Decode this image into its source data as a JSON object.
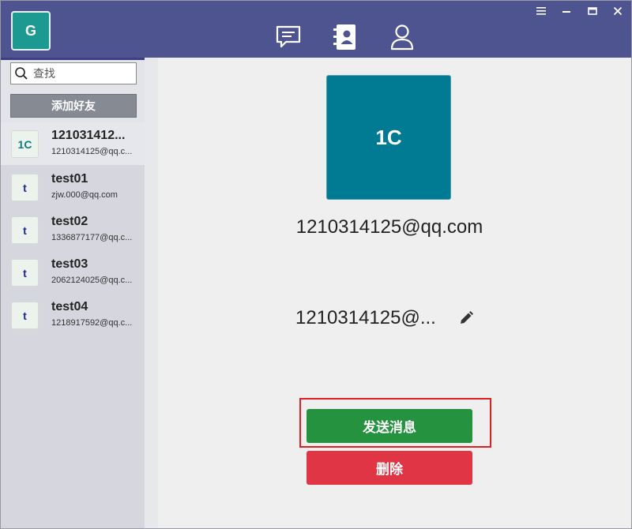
{
  "app": {
    "avatar_letter": "G",
    "accent_color": "#4e5490"
  },
  "nav": {
    "items": [
      {
        "icon": "chat-bubble-icon"
      },
      {
        "icon": "address-book-icon"
      },
      {
        "icon": "user-profile-icon"
      }
    ]
  },
  "window_controls": {
    "menu": "≡",
    "minimize": "—",
    "maximize": "□",
    "close": "✕"
  },
  "sidebar": {
    "search": {
      "placeholder": "查找",
      "value": ""
    },
    "add_friend_label": "添加好友",
    "contacts": [
      {
        "avatar": "1C",
        "name": "121031412...",
        "email": "1210314125@qq.c...",
        "selected": true
      },
      {
        "avatar": "t",
        "name": "test01",
        "email": "zjw.000@qq.com",
        "selected": false
      },
      {
        "avatar": "t",
        "name": "test02",
        "email": "1336877177@qq.c...",
        "selected": false
      },
      {
        "avatar": "t",
        "name": "test03",
        "email": "2062124025@qq.c...",
        "selected": false
      },
      {
        "avatar": "t",
        "name": "test04",
        "email": "1218917592@qq.c...",
        "selected": false
      }
    ]
  },
  "profile": {
    "avatar_text": "1C",
    "avatar_color": "#007b93",
    "email": "1210314125@qq.com",
    "nickname": "1210314125@..."
  },
  "actions": {
    "send_message_label": "发送消息",
    "send_message_color": "#25923f",
    "delete_label": "删除",
    "delete_color": "#e03545"
  }
}
